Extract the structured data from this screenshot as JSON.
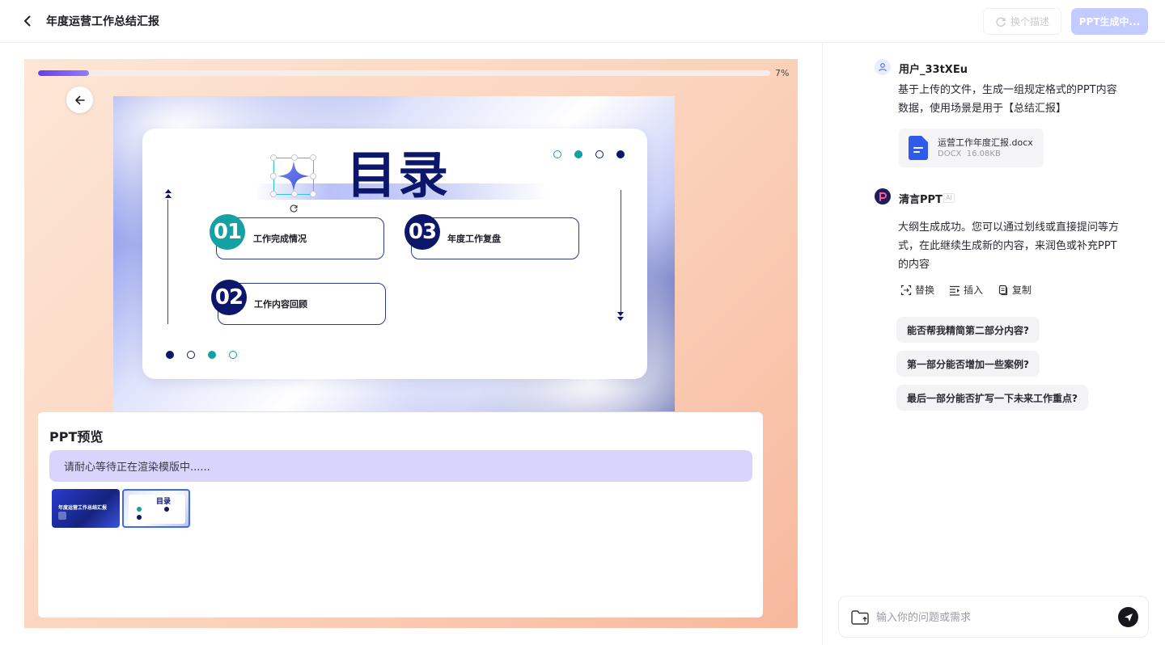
{
  "header": {
    "title": "年度运营工作总结汇报",
    "redesc_label": "换个描述",
    "generating_label": "PPT生成中..."
  },
  "progress": {
    "percent_label": "7%",
    "value": 0.07
  },
  "slide": {
    "title": "目录",
    "items": [
      {
        "num": "01",
        "label": "工作完成情况"
      },
      {
        "num": "02",
        "label": "工作内容回顾"
      },
      {
        "num": "03",
        "label": "年度工作复盘"
      }
    ]
  },
  "preview": {
    "title": "PPT预览",
    "status": "请耐心等待正在渲染模版中......",
    "thumbs": [
      {
        "title": "年度运营工作总结汇报"
      },
      {
        "title": "目录"
      }
    ]
  },
  "chat": {
    "user": {
      "name": "用户_33tXEu",
      "message": "基于上传的文件，生成一组规定格式的PPT内容数据，使用场景是用于【总结汇报】",
      "file": {
        "name": "运营工作年度汇报.docx",
        "type": "DOCX",
        "size": "16.08KB"
      }
    },
    "bot": {
      "name": "清言PPT",
      "badge": "AI",
      "message": "大纲生成成功。您可以通过划线或直接提问等方式，在此继续生成新的内容，来润色或补充PPT的内容",
      "actions": {
        "replace": "替换",
        "insert": "插入",
        "copy": "复制"
      }
    },
    "suggestions": [
      "能否帮我精简第二部分内容?",
      "第一部分能否增加一些案例?",
      "最后一部分能否扩写一下未来工作重点?"
    ]
  },
  "input": {
    "placeholder": "输入你的问题或需求"
  },
  "colors": {
    "accent": "#3d6bea",
    "navy": "#0c166b",
    "teal": "#14a1a3"
  }
}
